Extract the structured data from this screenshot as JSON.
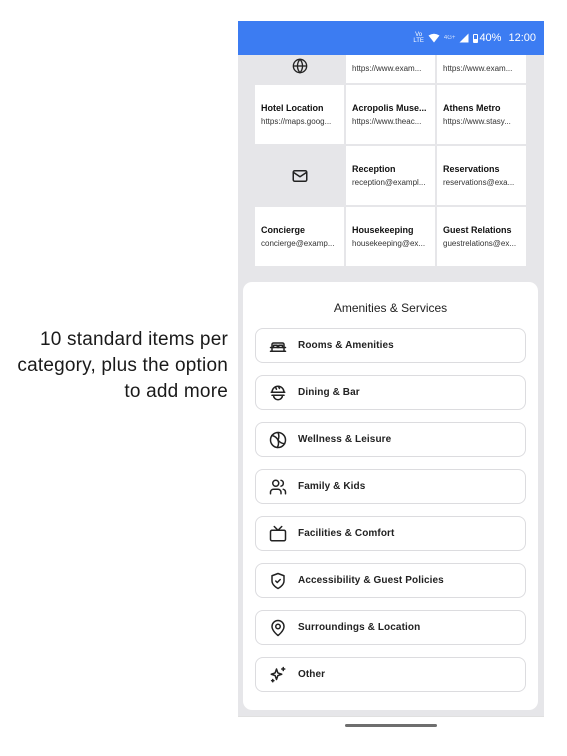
{
  "caption": "10 standard items per category, plus the option to add more",
  "status_bar": {
    "network_small": "VoLTE",
    "network_type": "4G+",
    "battery": "40%",
    "time": "12:00"
  },
  "links_row": {
    "items": [
      {
        "title": "",
        "url": "https://www.exam..."
      },
      {
        "title": "",
        "url": "https://www.exam..."
      }
    ]
  },
  "links": [
    {
      "title": "Hotel Location",
      "url": "https://maps.goog..."
    },
    {
      "title": "Acropolis Muse...",
      "url": "https://www.theac..."
    },
    {
      "title": "Athens Metro",
      "url": "https://www.stasy..."
    }
  ],
  "emails_row1": [
    {
      "title": "Reception",
      "email": "reception@exampl..."
    },
    {
      "title": "Reservations",
      "email": "reservations@exa..."
    }
  ],
  "emails_row2": [
    {
      "title": "Concierge",
      "email": "concierge@examp..."
    },
    {
      "title": "Housekeeping",
      "email": "housekeeping@ex..."
    },
    {
      "title": "Guest Relations",
      "email": "guestrelations@ex..."
    }
  ],
  "amenities": {
    "title": "Amenities & Services",
    "items": [
      {
        "label": "Rooms & Amenities",
        "icon": "bed-icon"
      },
      {
        "label": "Dining & Bar",
        "icon": "dining-icon"
      },
      {
        "label": "Wellness & Leisure",
        "icon": "volleyball-icon"
      },
      {
        "label": "Family & Kids",
        "icon": "users-icon"
      },
      {
        "label": "Facilities & Comfort",
        "icon": "tv-icon"
      },
      {
        "label": "Accessibility & Guest Policies",
        "icon": "shield-check-icon"
      },
      {
        "label": "Surroundings & Location",
        "icon": "map-pin-icon"
      },
      {
        "label": "Other",
        "icon": "sparkles-icon"
      }
    ]
  }
}
